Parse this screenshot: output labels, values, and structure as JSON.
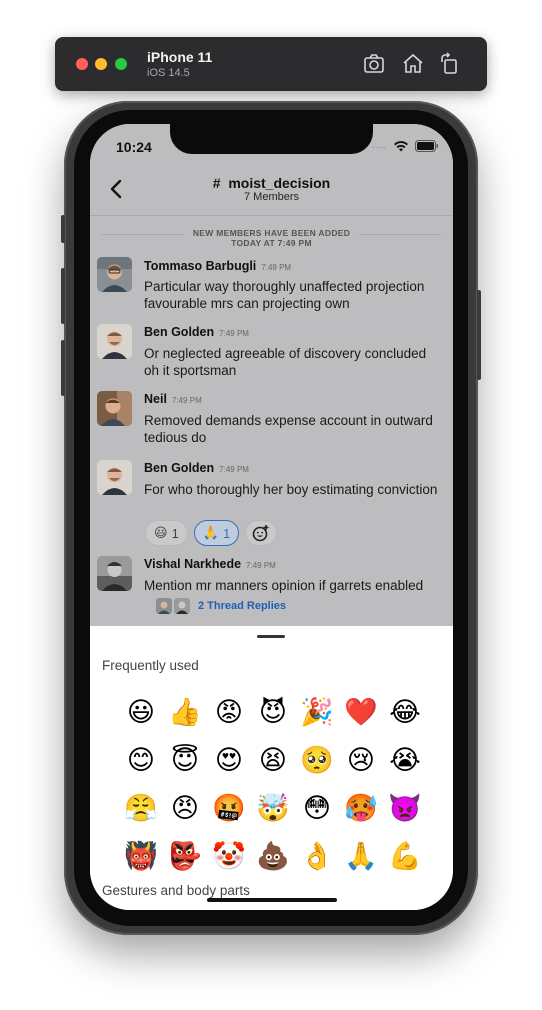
{
  "simulator": {
    "device": "iPhone 11",
    "os": "iOS 14.5",
    "icons": [
      "screenshot-icon",
      "home-icon",
      "rotate-icon"
    ]
  },
  "status_bar": {
    "time": "10:24",
    "signal": "....."
  },
  "header": {
    "channel": "#  moist_decision",
    "members": "7 Members"
  },
  "system_message": {
    "line1": "NEW MEMBERS HAVE BEEN ADDED",
    "line2": "TODAY AT 7:49 PM"
  },
  "messages": [
    {
      "author": "Tommaso Barbugli",
      "time": "7:49 PM",
      "text": "Particular way thoroughly unaffected projection favourable mrs can projecting own"
    },
    {
      "author": "Ben Golden",
      "time": "7:49 PM",
      "text": "Or neglected agreeable of discovery concluded oh it sportsman"
    },
    {
      "author": "Neil",
      "time": "7:49 PM",
      "text": "Removed demands expense account in outward tedious do"
    },
    {
      "author": "Ben Golden",
      "time": "7:49 PM",
      "text": "For who thoroughly her boy estimating conviction"
    },
    {
      "author": "Vishal Narkhede",
      "time": "7:49 PM",
      "text": "Mention mr manners opinion if garrets enabled"
    }
  ],
  "reactions": [
    {
      "emoji": "😃",
      "count": "1",
      "active": false
    },
    {
      "emoji": "🙏",
      "count": "1",
      "active": true
    }
  ],
  "thread": {
    "replies_label": "2 Thread Replies"
  },
  "emoji_picker": {
    "section_frequent": "Frequently used",
    "section_gestures": "Gestures and body parts",
    "emojis": [
      "😃",
      "👍",
      "😡",
      "😈",
      "🎉",
      "❤️",
      "😂",
      "😊",
      "😇",
      "😍",
      "😫",
      "🥺",
      "😢",
      "😭",
      "😤",
      "😠",
      "🤬",
      "🤯",
      "😳",
      "🥵",
      "👿",
      "👹",
      "👺",
      "🤡",
      "💩",
      "👌",
      "🙏",
      "💪"
    ]
  },
  "colors": {
    "accent": "#1f5fb4",
    "dimmed_background": "#bdbdbf",
    "active_reaction_border": "#3d6fb7"
  }
}
